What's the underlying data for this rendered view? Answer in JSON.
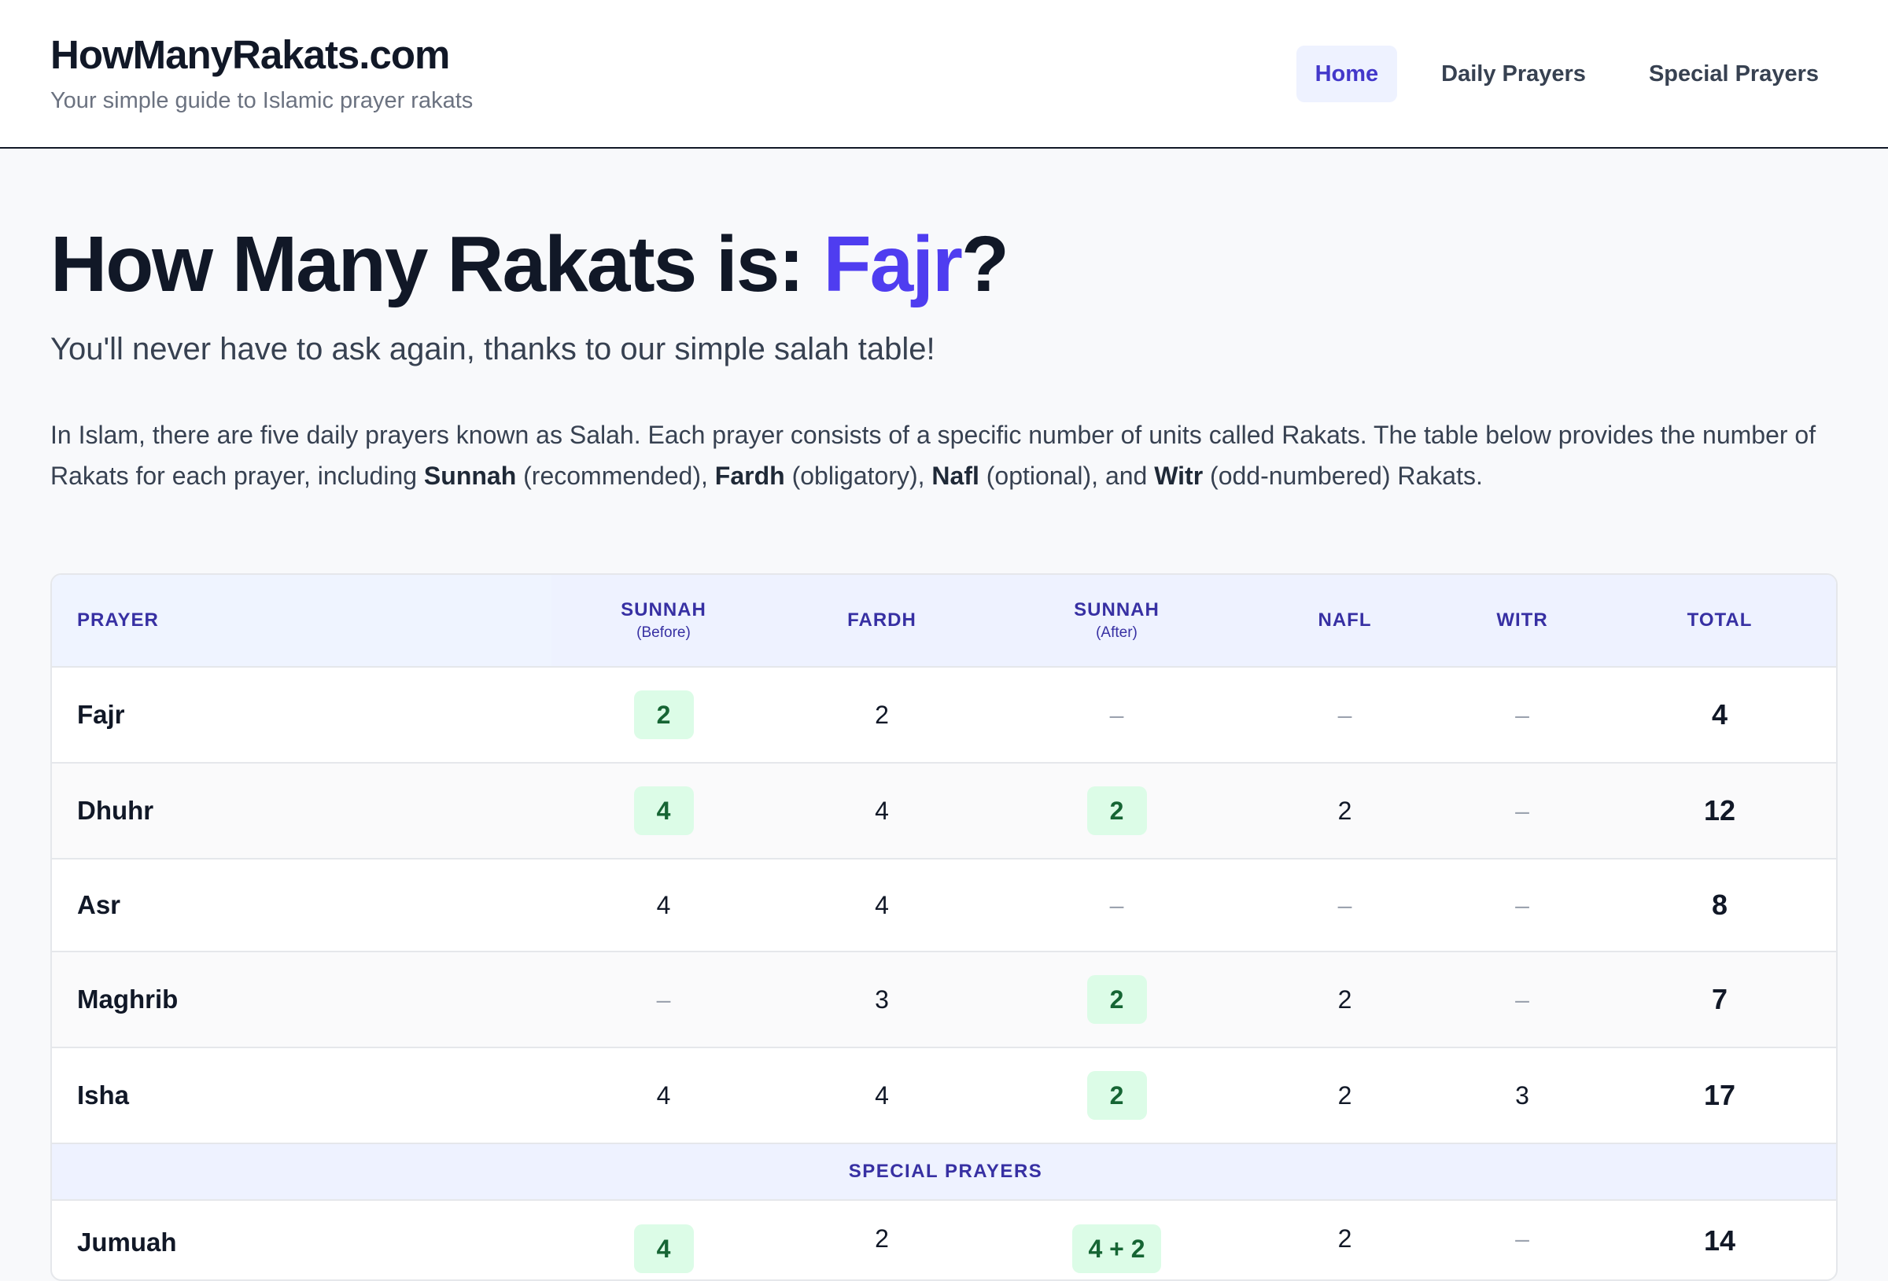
{
  "header": {
    "brand": "HowManyRakats.com",
    "tagline": "Your simple guide to Islamic prayer rakats",
    "nav": [
      {
        "label": "Home",
        "active": true
      },
      {
        "label": "Daily Prayers",
        "active": false
      },
      {
        "label": "Special Prayers",
        "active": false
      }
    ]
  },
  "main": {
    "title_prefix": "How Many Rakats is: ",
    "title_accent": "Fajr",
    "title_suffix": "?",
    "subtitle": "You'll never have to ask again, thanks to our simple salah table!",
    "intro": {
      "part1": "In Islam, there are five daily prayers known as Salah. Each prayer consists of a specific number of units called Rakats. The table below provides the number of Rakats for each prayer, including ",
      "sunnah": "Sunnah",
      "part2": " (recommended), ",
      "fardh": "Fardh",
      "part3": " (obligatory), ",
      "nafl": "Nafl",
      "part4": " (optional), and ",
      "witr": "Witr",
      "part5": " (odd-numbered) Rakats."
    }
  },
  "table": {
    "headers": {
      "prayer": "PRAYER",
      "sunnah_before": "SUNNAH",
      "sunnah_before_sub": "(Before)",
      "fardh": "FARDH",
      "sunnah_after": "SUNNAH",
      "sunnah_after_sub": "(After)",
      "nafl": "NAFL",
      "witr": "WITR",
      "total": "TOTAL"
    },
    "rows": [
      {
        "prayer": "Fajr",
        "sunnah_before": "2",
        "fardh": "2",
        "sunnah_after": "–",
        "nafl": "–",
        "witr": "–",
        "total": "4"
      },
      {
        "prayer": "Dhuhr",
        "sunnah_before": "4",
        "fardh": "4",
        "sunnah_after": "2",
        "nafl": "2",
        "witr": "–",
        "total": "12"
      },
      {
        "prayer": "Asr",
        "sunnah_before": "4",
        "fardh": "4",
        "sunnah_after": "–",
        "nafl": "–",
        "witr": "–",
        "total": "8"
      },
      {
        "prayer": "Maghrib",
        "sunnah_before": "–",
        "fardh": "3",
        "sunnah_after": "2",
        "nafl": "2",
        "witr": "–",
        "total": "7"
      },
      {
        "prayer": "Isha",
        "sunnah_before": "4",
        "fardh": "4",
        "sunnah_after": "2",
        "nafl": "2",
        "witr": "3",
        "total": "17"
      }
    ],
    "section_label": "SPECIAL PRAYERS",
    "special_rows": [
      {
        "prayer": "Jumuah",
        "sunnah_before": "4",
        "fardh": "2",
        "sunnah_after": "4 + 2",
        "nafl": "2",
        "witr": "–",
        "total": "14"
      }
    ]
  },
  "colors": {
    "accent": "#4f3df0",
    "highlight_bg": "#dcfce7",
    "highlight_text": "#166534",
    "header_bg": "#eef2ff",
    "header_text": "#3730a3"
  }
}
